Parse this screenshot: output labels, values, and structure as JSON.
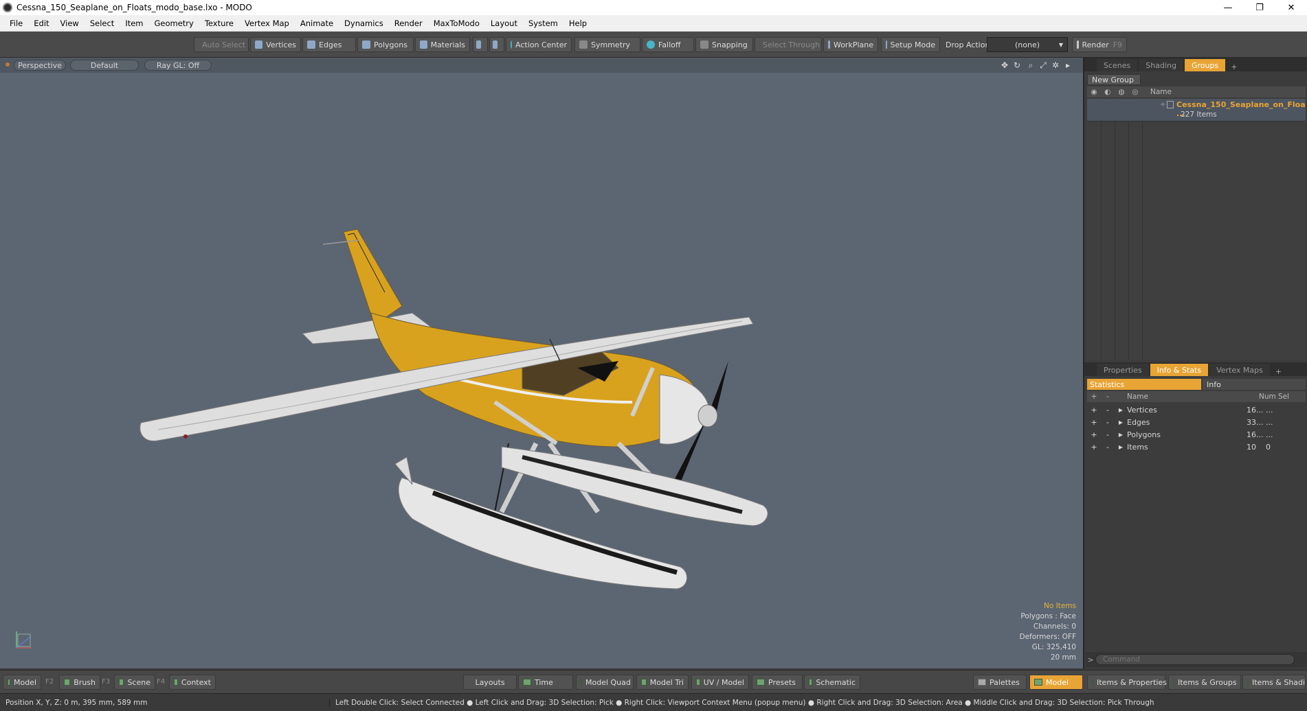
{
  "window": {
    "title": "Cessna_150_Seaplane_on_Floats_modo_base.lxo - MODO",
    "min": "—",
    "max": "❐",
    "close": "✕"
  },
  "menu": [
    "File",
    "Edit",
    "View",
    "Select",
    "Item",
    "Geometry",
    "Texture",
    "Vertex Map",
    "Animate",
    "Dynamics",
    "Render",
    "MaxToModo",
    "Layout",
    "System",
    "Help"
  ],
  "toolbar": {
    "auto_select": "Auto Select",
    "vertices": "Vertices",
    "edges": "Edges",
    "polygons": "Polygons",
    "materials": "Materials",
    "action_center": "Action Center",
    "symmetry": "Symmetry",
    "falloff": "Falloff",
    "snapping": "Snapping",
    "select_through": "Select Through",
    "workplane": "WorkPlane",
    "setup_mode": "Setup Mode",
    "drop_action_label": "Drop Action",
    "drop_action_value": "(none)",
    "render": "Render",
    "render_key": "F9"
  },
  "viewport": {
    "perspective": "Perspective",
    "default": "Default",
    "raygl": "Ray GL: Off",
    "info": {
      "items": "No Items",
      "polygons": "Polygons : Face",
      "channels": "Channels: 0",
      "deformers": "Deformers: OFF",
      "gl": "GL: 325,410",
      "scale": "20 mm"
    }
  },
  "groups_panel": {
    "tabs": [
      "Scenes",
      "Shading",
      "Groups"
    ],
    "new_group": "New Group",
    "name_header": "Name",
    "item_name": "Cessna_150_Seaplane_on_Floa ...",
    "item_count": "227 Items"
  },
  "stats_panel": {
    "tabs": [
      "Properties",
      "Info & Stats",
      "Vertex Maps"
    ],
    "subtabs": [
      "Statistics",
      "Info"
    ],
    "headers": {
      "name": "Name",
      "num": "Num",
      "sel": "Sel"
    },
    "rows": [
      {
        "name": "Vertices",
        "num": "16...",
        "sel": "..."
      },
      {
        "name": "Edges",
        "num": "33...",
        "sel": "..."
      },
      {
        "name": "Polygons",
        "num": "16...",
        "sel": "..."
      },
      {
        "name": "Items",
        "num": "10",
        "sel": "0"
      }
    ],
    "command_placeholder": "Command"
  },
  "bottombar": {
    "model": "Model",
    "f2": "F2",
    "brush": "Brush",
    "f3": "F3",
    "scene": "Scene",
    "f4": "F4",
    "context": "Context",
    "layouts": "Layouts",
    "time": "Time",
    "model_quad": "Model Quad",
    "model_tri": "Model Tri",
    "uv_model": "UV / Model",
    "presets": "Presets",
    "schematic": "Schematic",
    "palettes": "Palettes",
    "model_active": "Model",
    "items_properties": "Items & Properties",
    "items_groups": "Items & Groups",
    "items_shading": "Items & Shadin"
  },
  "statusbar": {
    "position": "Position X, Y, Z:   0 m, 395 mm, 589 mm",
    "hints": "Left Double Click: Select Connected ● Left Click and Drag: 3D Selection: Pick ● Right Click: Viewport Context Menu (popup menu) ● Right Click and Drag: 3D Selection: Area ● Middle Click and Drag: 3D Selection: Pick Through"
  },
  "colors": {
    "accent": "#e8a435",
    "viewport_bg": "#5c6672",
    "plane_yellow": "#d9a21e"
  }
}
